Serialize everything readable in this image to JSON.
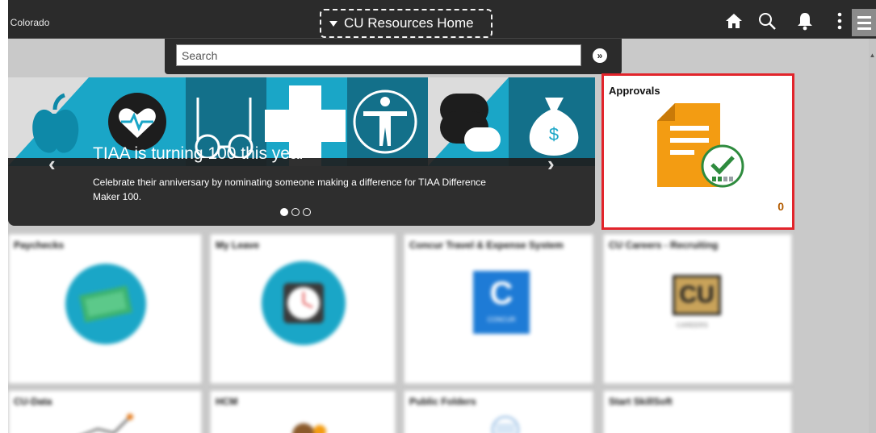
{
  "header": {
    "brand_text": "! Colorado",
    "home_selector_label": "CU Resources Home",
    "icons": [
      "home-icon",
      "search-icon",
      "bell-icon",
      "more-vertical-icon",
      "hamburger-menu-icon"
    ]
  },
  "search": {
    "placeholder": "Search",
    "go_icon": "»"
  },
  "carousel": {
    "title": "TIAA is turning 100 this year",
    "text": "Celebrate their anniversary by nominating someone making a difference for TIAA Difference Maker 100.",
    "prev_label": "‹",
    "next_label": "›",
    "slides": 3,
    "active_slide": 1,
    "art_icons": [
      "apple-icon",
      "heart-pulse-icon",
      "glasses-icon",
      "plus-icon",
      "person-icon",
      "pill-icon",
      "money-bag-icon"
    ]
  },
  "tiles": {
    "approvals": {
      "title": "Approvals",
      "count": "0"
    },
    "paychecks": {
      "title": "Paychecks"
    },
    "my_leave": {
      "title": "My Leave"
    },
    "concur": {
      "title": "Concur Travel & Expense System",
      "logo_text": "CONCUR"
    },
    "cu_careers": {
      "title": "CU Careers - Recruiting",
      "logo_text": "CAREERS"
    },
    "cu_data": {
      "title": "CU-Data"
    },
    "hcm": {
      "title": "HCM"
    },
    "public_folders": {
      "title": "Public Folders"
    },
    "start_skillsoft": {
      "title": "Start SkillSoft"
    }
  },
  "colors": {
    "header_bg": "#2b2b2b",
    "highlight_border": "#e2242b",
    "approvals_doc": "#f39c12",
    "approvals_check": "#2e8b3e",
    "banner_teal": "#1aa6c7",
    "count_color": "#b35b00"
  }
}
